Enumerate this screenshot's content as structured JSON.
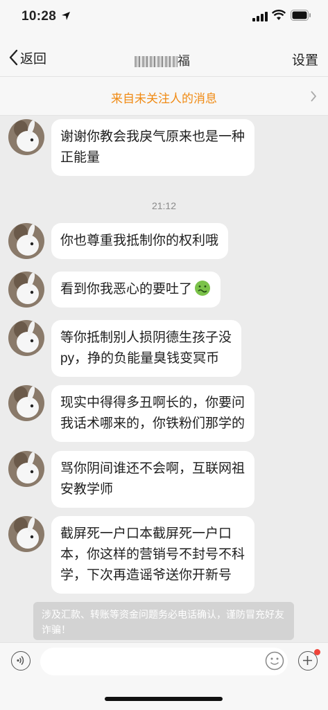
{
  "status_bar": {
    "time": "10:28"
  },
  "nav": {
    "back_label": "返回",
    "title_visible_suffix": "福",
    "settings_label": "设置"
  },
  "banner": {
    "text": "来自未关注人的消息"
  },
  "messages": [
    {
      "text_lines": [
        "谢谢你教会我戾气原来也是一种",
        "正能量"
      ]
    },
    {
      "text_lines": [
        "你也尊重我抵制你的权利哦"
      ]
    },
    {
      "text_lines": [
        "看到你我恶心的要吐了"
      ],
      "emoji": "nauseated-face"
    },
    {
      "text_lines": [
        "等你抵制别人损阴德生孩子没",
        "py，挣的负能量臭钱变冥币"
      ]
    },
    {
      "text_lines": [
        "现实中得得多丑啊长的，你要问",
        "我话术哪来的，你铁粉们那学的"
      ]
    },
    {
      "text_lines": [
        "骂你阴间谁还不会啊，互联网祖",
        "安教学师"
      ]
    },
    {
      "text_lines": [
        "截屏死一户口本截屏死一户口",
        "本，你这样的营销号不封号不科",
        "学，下次再造谣爷送你开新号"
      ]
    }
  ],
  "timestamp": "21:12",
  "notice": {
    "text": "涉及汇款、转账等资金问题务必电话确认，谨防冒充好友诈骗！"
  },
  "icons": {
    "back": "chevron-left-icon",
    "banner": "chevron-right-icon",
    "voice": "voice-icon",
    "emoji": "smile-icon",
    "plus": "plus-icon"
  },
  "colors": {
    "accent": "#f08a13",
    "background": "#ececec",
    "badge": "#f0443a"
  }
}
